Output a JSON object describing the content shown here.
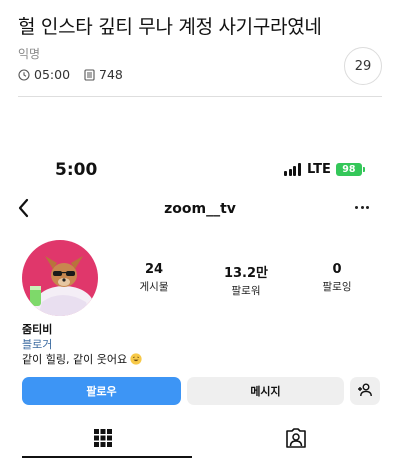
{
  "post": {
    "title": "헐 인스타 깊티 무나 계정 사기구라였네",
    "author": "익명",
    "time": "05:00",
    "views": "748",
    "comment_count": "29"
  },
  "phone": {
    "status_bar": {
      "time": "5:00",
      "network": "LTE",
      "battery": "98"
    },
    "header": {
      "username": "zoom__tv"
    },
    "profile": {
      "posts": {
        "value": "24",
        "label": "게시물"
      },
      "followers": {
        "value": "13.2만",
        "label": "팔로워"
      },
      "following": {
        "value": "0",
        "label": "팔로잉"
      },
      "name": "줌티비",
      "category": "블로거",
      "bio": "같이 힐링, 같이 웃어요"
    },
    "buttons": {
      "follow": "팔로우",
      "message": "메시지"
    },
    "tabs": {
      "grid_icon": "grid-icon",
      "tagged_icon": "tagged-person-icon"
    }
  },
  "colors": {
    "follow_button": "#3d95f5",
    "category_link": "#3b6aa0",
    "battery": "#34c759",
    "avatar_bg": "#e0376b"
  }
}
